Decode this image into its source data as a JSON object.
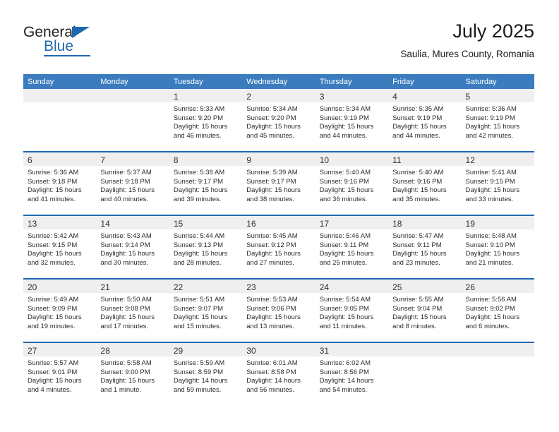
{
  "brand": {
    "name_top": "General",
    "name_bottom": "Blue",
    "accent_color": "#1f68b0"
  },
  "header": {
    "title": "July 2025",
    "subtitle": "Saulia, Mures County, Romania"
  },
  "theme": {
    "header_bar_color": "#3a7cbe",
    "row_divider_color": "#1f68b0",
    "daynum_band_color": "#efefef"
  },
  "weekdays": [
    "Sunday",
    "Monday",
    "Tuesday",
    "Wednesday",
    "Thursday",
    "Friday",
    "Saturday"
  ],
  "weeks": [
    [
      {
        "day": "",
        "lines": []
      },
      {
        "day": "",
        "lines": []
      },
      {
        "day": "1",
        "lines": [
          "Sunrise: 5:33 AM",
          "Sunset: 9:20 PM",
          "Daylight: 15 hours",
          "and 46 minutes."
        ]
      },
      {
        "day": "2",
        "lines": [
          "Sunrise: 5:34 AM",
          "Sunset: 9:20 PM",
          "Daylight: 15 hours",
          "and 45 minutes."
        ]
      },
      {
        "day": "3",
        "lines": [
          "Sunrise: 5:34 AM",
          "Sunset: 9:19 PM",
          "Daylight: 15 hours",
          "and 44 minutes."
        ]
      },
      {
        "day": "4",
        "lines": [
          "Sunrise: 5:35 AM",
          "Sunset: 9:19 PM",
          "Daylight: 15 hours",
          "and 44 minutes."
        ]
      },
      {
        "day": "5",
        "lines": [
          "Sunrise: 5:36 AM",
          "Sunset: 9:19 PM",
          "Daylight: 15 hours",
          "and 42 minutes."
        ]
      }
    ],
    [
      {
        "day": "6",
        "lines": [
          "Sunrise: 5:36 AM",
          "Sunset: 9:18 PM",
          "Daylight: 15 hours",
          "and 41 minutes."
        ]
      },
      {
        "day": "7",
        "lines": [
          "Sunrise: 5:37 AM",
          "Sunset: 9:18 PM",
          "Daylight: 15 hours",
          "and 40 minutes."
        ]
      },
      {
        "day": "8",
        "lines": [
          "Sunrise: 5:38 AM",
          "Sunset: 9:17 PM",
          "Daylight: 15 hours",
          "and 39 minutes."
        ]
      },
      {
        "day": "9",
        "lines": [
          "Sunrise: 5:39 AM",
          "Sunset: 9:17 PM",
          "Daylight: 15 hours",
          "and 38 minutes."
        ]
      },
      {
        "day": "10",
        "lines": [
          "Sunrise: 5:40 AM",
          "Sunset: 9:16 PM",
          "Daylight: 15 hours",
          "and 36 minutes."
        ]
      },
      {
        "day": "11",
        "lines": [
          "Sunrise: 5:40 AM",
          "Sunset: 9:16 PM",
          "Daylight: 15 hours",
          "and 35 minutes."
        ]
      },
      {
        "day": "12",
        "lines": [
          "Sunrise: 5:41 AM",
          "Sunset: 9:15 PM",
          "Daylight: 15 hours",
          "and 33 minutes."
        ]
      }
    ],
    [
      {
        "day": "13",
        "lines": [
          "Sunrise: 5:42 AM",
          "Sunset: 9:15 PM",
          "Daylight: 15 hours",
          "and 32 minutes."
        ]
      },
      {
        "day": "14",
        "lines": [
          "Sunrise: 5:43 AM",
          "Sunset: 9:14 PM",
          "Daylight: 15 hours",
          "and 30 minutes."
        ]
      },
      {
        "day": "15",
        "lines": [
          "Sunrise: 5:44 AM",
          "Sunset: 9:13 PM",
          "Daylight: 15 hours",
          "and 28 minutes."
        ]
      },
      {
        "day": "16",
        "lines": [
          "Sunrise: 5:45 AM",
          "Sunset: 9:12 PM",
          "Daylight: 15 hours",
          "and 27 minutes."
        ]
      },
      {
        "day": "17",
        "lines": [
          "Sunrise: 5:46 AM",
          "Sunset: 9:11 PM",
          "Daylight: 15 hours",
          "and 25 minutes."
        ]
      },
      {
        "day": "18",
        "lines": [
          "Sunrise: 5:47 AM",
          "Sunset: 9:11 PM",
          "Daylight: 15 hours",
          "and 23 minutes."
        ]
      },
      {
        "day": "19",
        "lines": [
          "Sunrise: 5:48 AM",
          "Sunset: 9:10 PM",
          "Daylight: 15 hours",
          "and 21 minutes."
        ]
      }
    ],
    [
      {
        "day": "20",
        "lines": [
          "Sunrise: 5:49 AM",
          "Sunset: 9:09 PM",
          "Daylight: 15 hours",
          "and 19 minutes."
        ]
      },
      {
        "day": "21",
        "lines": [
          "Sunrise: 5:50 AM",
          "Sunset: 9:08 PM",
          "Daylight: 15 hours",
          "and 17 minutes."
        ]
      },
      {
        "day": "22",
        "lines": [
          "Sunrise: 5:51 AM",
          "Sunset: 9:07 PM",
          "Daylight: 15 hours",
          "and 15 minutes."
        ]
      },
      {
        "day": "23",
        "lines": [
          "Sunrise: 5:53 AM",
          "Sunset: 9:06 PM",
          "Daylight: 15 hours",
          "and 13 minutes."
        ]
      },
      {
        "day": "24",
        "lines": [
          "Sunrise: 5:54 AM",
          "Sunset: 9:05 PM",
          "Daylight: 15 hours",
          "and 11 minutes."
        ]
      },
      {
        "day": "25",
        "lines": [
          "Sunrise: 5:55 AM",
          "Sunset: 9:04 PM",
          "Daylight: 15 hours",
          "and 8 minutes."
        ]
      },
      {
        "day": "26",
        "lines": [
          "Sunrise: 5:56 AM",
          "Sunset: 9:02 PM",
          "Daylight: 15 hours",
          "and 6 minutes."
        ]
      }
    ],
    [
      {
        "day": "27",
        "lines": [
          "Sunrise: 5:57 AM",
          "Sunset: 9:01 PM",
          "Daylight: 15 hours",
          "and 4 minutes."
        ]
      },
      {
        "day": "28",
        "lines": [
          "Sunrise: 5:58 AM",
          "Sunset: 9:00 PM",
          "Daylight: 15 hours",
          "and 1 minute."
        ]
      },
      {
        "day": "29",
        "lines": [
          "Sunrise: 5:59 AM",
          "Sunset: 8:59 PM",
          "Daylight: 14 hours",
          "and 59 minutes."
        ]
      },
      {
        "day": "30",
        "lines": [
          "Sunrise: 6:01 AM",
          "Sunset: 8:58 PM",
          "Daylight: 14 hours",
          "and 56 minutes."
        ]
      },
      {
        "day": "31",
        "lines": [
          "Sunrise: 6:02 AM",
          "Sunset: 8:56 PM",
          "Daylight: 14 hours",
          "and 54 minutes."
        ]
      },
      {
        "day": "",
        "lines": []
      },
      {
        "day": "",
        "lines": []
      }
    ]
  ]
}
